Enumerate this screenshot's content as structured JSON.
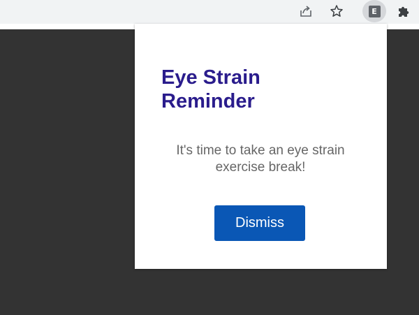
{
  "browser_toolbar": {
    "icons": [
      "share-icon",
      "bookmark-star-icon",
      "extension-icon",
      "extensions-puzzle-icon"
    ],
    "extension_badge_letter": "E"
  },
  "popup": {
    "title": "Eye Strain Reminder",
    "message": "It's time to take an eye strain exercise break!",
    "dismiss_label": "Dismiss"
  },
  "colors": {
    "title": "#2a1c8c",
    "message": "#666666",
    "button": "#0a57b5",
    "page_background": "#333333",
    "toolbar": "#f1f3f4"
  }
}
